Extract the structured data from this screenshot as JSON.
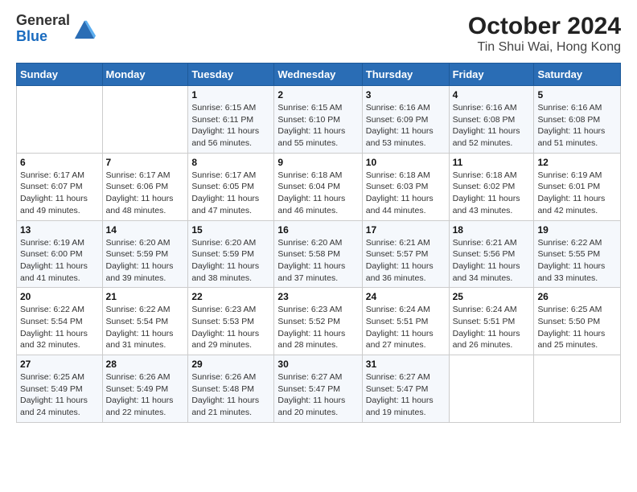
{
  "logo": {
    "line1": "General",
    "line2": "Blue"
  },
  "title": "October 2024",
  "subtitle": "Tin Shui Wai, Hong Kong",
  "days_of_week": [
    "Sunday",
    "Monday",
    "Tuesday",
    "Wednesday",
    "Thursday",
    "Friday",
    "Saturday"
  ],
  "weeks": [
    [
      {
        "day": "",
        "sunrise": "",
        "sunset": "",
        "daylight": ""
      },
      {
        "day": "",
        "sunrise": "",
        "sunset": "",
        "daylight": ""
      },
      {
        "day": "1",
        "sunrise": "Sunrise: 6:15 AM",
        "sunset": "Sunset: 6:11 PM",
        "daylight": "Daylight: 11 hours and 56 minutes."
      },
      {
        "day": "2",
        "sunrise": "Sunrise: 6:15 AM",
        "sunset": "Sunset: 6:10 PM",
        "daylight": "Daylight: 11 hours and 55 minutes."
      },
      {
        "day": "3",
        "sunrise": "Sunrise: 6:16 AM",
        "sunset": "Sunset: 6:09 PM",
        "daylight": "Daylight: 11 hours and 53 minutes."
      },
      {
        "day": "4",
        "sunrise": "Sunrise: 6:16 AM",
        "sunset": "Sunset: 6:08 PM",
        "daylight": "Daylight: 11 hours and 52 minutes."
      },
      {
        "day": "5",
        "sunrise": "Sunrise: 6:16 AM",
        "sunset": "Sunset: 6:08 PM",
        "daylight": "Daylight: 11 hours and 51 minutes."
      }
    ],
    [
      {
        "day": "6",
        "sunrise": "Sunrise: 6:17 AM",
        "sunset": "Sunset: 6:07 PM",
        "daylight": "Daylight: 11 hours and 49 minutes."
      },
      {
        "day": "7",
        "sunrise": "Sunrise: 6:17 AM",
        "sunset": "Sunset: 6:06 PM",
        "daylight": "Daylight: 11 hours and 48 minutes."
      },
      {
        "day": "8",
        "sunrise": "Sunrise: 6:17 AM",
        "sunset": "Sunset: 6:05 PM",
        "daylight": "Daylight: 11 hours and 47 minutes."
      },
      {
        "day": "9",
        "sunrise": "Sunrise: 6:18 AM",
        "sunset": "Sunset: 6:04 PM",
        "daylight": "Daylight: 11 hours and 46 minutes."
      },
      {
        "day": "10",
        "sunrise": "Sunrise: 6:18 AM",
        "sunset": "Sunset: 6:03 PM",
        "daylight": "Daylight: 11 hours and 44 minutes."
      },
      {
        "day": "11",
        "sunrise": "Sunrise: 6:18 AM",
        "sunset": "Sunset: 6:02 PM",
        "daylight": "Daylight: 11 hours and 43 minutes."
      },
      {
        "day": "12",
        "sunrise": "Sunrise: 6:19 AM",
        "sunset": "Sunset: 6:01 PM",
        "daylight": "Daylight: 11 hours and 42 minutes."
      }
    ],
    [
      {
        "day": "13",
        "sunrise": "Sunrise: 6:19 AM",
        "sunset": "Sunset: 6:00 PM",
        "daylight": "Daylight: 11 hours and 41 minutes."
      },
      {
        "day": "14",
        "sunrise": "Sunrise: 6:20 AM",
        "sunset": "Sunset: 5:59 PM",
        "daylight": "Daylight: 11 hours and 39 minutes."
      },
      {
        "day": "15",
        "sunrise": "Sunrise: 6:20 AM",
        "sunset": "Sunset: 5:59 PM",
        "daylight": "Daylight: 11 hours and 38 minutes."
      },
      {
        "day": "16",
        "sunrise": "Sunrise: 6:20 AM",
        "sunset": "Sunset: 5:58 PM",
        "daylight": "Daylight: 11 hours and 37 minutes."
      },
      {
        "day": "17",
        "sunrise": "Sunrise: 6:21 AM",
        "sunset": "Sunset: 5:57 PM",
        "daylight": "Daylight: 11 hours and 36 minutes."
      },
      {
        "day": "18",
        "sunrise": "Sunrise: 6:21 AM",
        "sunset": "Sunset: 5:56 PM",
        "daylight": "Daylight: 11 hours and 34 minutes."
      },
      {
        "day": "19",
        "sunrise": "Sunrise: 6:22 AM",
        "sunset": "Sunset: 5:55 PM",
        "daylight": "Daylight: 11 hours and 33 minutes."
      }
    ],
    [
      {
        "day": "20",
        "sunrise": "Sunrise: 6:22 AM",
        "sunset": "Sunset: 5:54 PM",
        "daylight": "Daylight: 11 hours and 32 minutes."
      },
      {
        "day": "21",
        "sunrise": "Sunrise: 6:22 AM",
        "sunset": "Sunset: 5:54 PM",
        "daylight": "Daylight: 11 hours and 31 minutes."
      },
      {
        "day": "22",
        "sunrise": "Sunrise: 6:23 AM",
        "sunset": "Sunset: 5:53 PM",
        "daylight": "Daylight: 11 hours and 29 minutes."
      },
      {
        "day": "23",
        "sunrise": "Sunrise: 6:23 AM",
        "sunset": "Sunset: 5:52 PM",
        "daylight": "Daylight: 11 hours and 28 minutes."
      },
      {
        "day": "24",
        "sunrise": "Sunrise: 6:24 AM",
        "sunset": "Sunset: 5:51 PM",
        "daylight": "Daylight: 11 hours and 27 minutes."
      },
      {
        "day": "25",
        "sunrise": "Sunrise: 6:24 AM",
        "sunset": "Sunset: 5:51 PM",
        "daylight": "Daylight: 11 hours and 26 minutes."
      },
      {
        "day": "26",
        "sunrise": "Sunrise: 6:25 AM",
        "sunset": "Sunset: 5:50 PM",
        "daylight": "Daylight: 11 hours and 25 minutes."
      }
    ],
    [
      {
        "day": "27",
        "sunrise": "Sunrise: 6:25 AM",
        "sunset": "Sunset: 5:49 PM",
        "daylight": "Daylight: 11 hours and 24 minutes."
      },
      {
        "day": "28",
        "sunrise": "Sunrise: 6:26 AM",
        "sunset": "Sunset: 5:49 PM",
        "daylight": "Daylight: 11 hours and 22 minutes."
      },
      {
        "day": "29",
        "sunrise": "Sunrise: 6:26 AM",
        "sunset": "Sunset: 5:48 PM",
        "daylight": "Daylight: 11 hours and 21 minutes."
      },
      {
        "day": "30",
        "sunrise": "Sunrise: 6:27 AM",
        "sunset": "Sunset: 5:47 PM",
        "daylight": "Daylight: 11 hours and 20 minutes."
      },
      {
        "day": "31",
        "sunrise": "Sunrise: 6:27 AM",
        "sunset": "Sunset: 5:47 PM",
        "daylight": "Daylight: 11 hours and 19 minutes."
      },
      {
        "day": "",
        "sunrise": "",
        "sunset": "",
        "daylight": ""
      },
      {
        "day": "",
        "sunrise": "",
        "sunset": "",
        "daylight": ""
      }
    ]
  ]
}
